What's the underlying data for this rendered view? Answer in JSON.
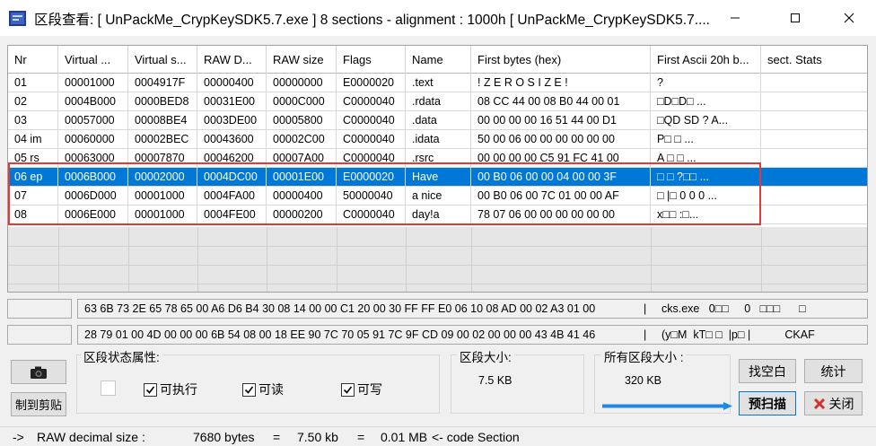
{
  "window": {
    "title": "区段查看: [ UnPackMe_CrypKeySDK5.7.exe ] 8 sections - alignment : 1000h [ UnPackMe_CrypKeySDK5.7...."
  },
  "table": {
    "columns": [
      "Nr",
      "Virtual ...",
      "Virtual s...",
      "RAW D...",
      "RAW size",
      "Flags",
      "Name",
      "First bytes (hex)",
      "First Ascii 20h b...",
      "sect. Stats"
    ],
    "rows": [
      {
        "nr": "01",
        "vaddr": "00001000",
        "vsize": "0004917F",
        "rawd": "00000400",
        "rawsize": "00000000",
        "flags": "E0000020",
        "name": ".text",
        "hex": " ! Z E R O   S I Z E !",
        "ascii": "?",
        "stats": ""
      },
      {
        "nr": "02",
        "vaddr": "0004B000",
        "vsize": "0000BED8",
        "rawd": "00031E00",
        "rawsize": "0000C000",
        "flags": "C0000040",
        "name": ".rdata",
        "hex": "08 CC 44 00 08 B0 44 00 01",
        "ascii": "□D□D□   ...",
        "stats": ""
      },
      {
        "nr": "03",
        "vaddr": "00057000",
        "vsize": "00008BE4",
        "rawd": "0003DE00",
        "rawsize": "00005800",
        "flags": "C0000040",
        "name": ".data",
        "hex": "00 00 00 00 16 51 44 00 D1",
        "ascii": "    □QD  SD ? A...",
        "stats": ""
      },
      {
        "nr": "04 im",
        "vaddr": "00060000",
        "vsize": "00002BEC",
        "rawd": "00043600",
        "rawsize": "00002C00",
        "flags": "C0000040",
        "name": ".idata",
        "hex": "50 00 06 00 00 00 00 00 00",
        "ascii": "P□            □   ...",
        "stats": ""
      },
      {
        "nr": "05 rs",
        "vaddr": "00063000",
        "vsize": "00007870",
        "rawd": "00046200",
        "rawsize": "00007A00",
        "flags": "C0000040",
        "name": ".rsrc",
        "hex": "00 00 00 00 C5 91 FC 41 00",
        "ascii": "          A    □ □ ...",
        "stats": ""
      },
      {
        "nr": "06 ep",
        "vaddr": "0006B000",
        "vsize": "00002000",
        "rawd": "0004DC00",
        "rawsize": "00001E00",
        "flags": "E0000020",
        "name": "Have",
        "hex": "00 B0 06 00 00 04 00 00 3F",
        "ascii": "   □  □  ?□□  ...",
        "stats": ""
      },
      {
        "nr": "07",
        "vaddr": "0006D000",
        "vsize": "00001000",
        "rawd": "0004FA00",
        "rawsize": "00000400",
        "flags": "50000040",
        "name": "a nice",
        "hex": "00 B0 06 00 7C 01 00 00 AF",
        "ascii": "   □ |□   0 0 0 ...",
        "stats": ""
      },
      {
        "nr": "08",
        "vaddr": "0006E000",
        "vsize": "00001000",
        "rawd": "0004FE00",
        "rawsize": "00000200",
        "flags": "C0000040",
        "name": "day!a",
        "hex": "78 07 06 00 00 00 00 00 00",
        "ascii": "x□□          :□...",
        "stats": ""
      }
    ],
    "selected_row": 5
  },
  "hex_lines": [
    {
      "hex": "63 6B 73 2E 65 78 65 00 A6 D6 B4 30 08 14 00 00 C1 20 00 30 FF FF E0 06 10 08 AD 00 02 A3 01 00",
      "sep": "|",
      "ascii": "cks.exe   0□□     0   □□□      □"
    },
    {
      "hex": "28 79 01 00 4D 00 00 00 6B 54 08 00 18 EE 90 7C 70 05 91 7C 9F CD 09 00 02 00 00 00 43 4B 41 46",
      "sep": "|",
      "ascii": "(y□M  kT□ □  |p□ |           CKAF"
    }
  ],
  "properties": {
    "label": "区段状态属性:",
    "exec_label": "可执行",
    "read_label": "可读",
    "write_label": "可写"
  },
  "section_size": {
    "label": "区段大小:",
    "value": "7.5 KB"
  },
  "all_sections_size": {
    "label": "所有区段大小 :",
    "value": "320 KB"
  },
  "buttons": {
    "clipboard": "制到剪贴",
    "find_blank": "找空白",
    "stats": "统计",
    "prescan": "预扫描",
    "close": "关闭"
  },
  "status": {
    "arrow": "->",
    "label": "RAW decimal size :",
    "bytes": "7680 bytes",
    "eq1": "=",
    "kb": "7.50 kb",
    "eq2": "=",
    "mb": "0.01 MB",
    "note": "<- code Section"
  },
  "colors": {
    "selection": "#0078d7",
    "highlight": "#e53935",
    "progress": "#1e88e5"
  }
}
